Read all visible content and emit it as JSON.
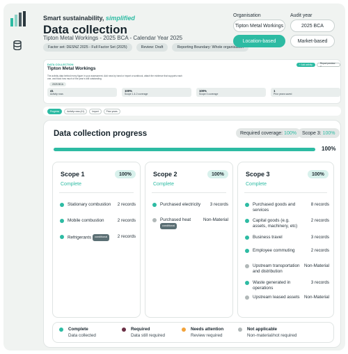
{
  "brand": {
    "tagline": "Smart sustainability,",
    "tagline_accent": "simplified"
  },
  "header": {
    "title": "Data collection",
    "subtitle": "Tipton Metal Workings - 2025 BCA - Calendar Year 2025",
    "pills": [
      "Factor set: DESNZ 2025 - Full Factor Set (2025)",
      "Review: Draft",
      "Reporting Boundary: Whole organisation"
    ]
  },
  "controls": {
    "organisation_label": "Organisation",
    "organisation_value": "Tipton Metal Workings",
    "audit_year_label": "Audit year",
    "audit_year_value": "2025 BCA",
    "location_button": "Location-based",
    "market_button": "Market-based"
  },
  "mini_card": {
    "eyebrow": "DATA COLLECTION",
    "title": "Tipton Metal Workings",
    "description": "The activity data behind every figure in your assessment. Add rows by hand or import a workbook, attach the evidence that supports each one, and track how much of the year is still outstanding.",
    "tag": "2025 BCA",
    "add_button": "+ Add activity",
    "report_button": "Report preview >",
    "stats": [
      {
        "value": "41",
        "label": "Activity rows"
      },
      {
        "value": "100%",
        "label": "Scope 1 & 2 coverage"
      },
      {
        "value": "100%",
        "label": "Scope 3 coverage"
      },
      {
        "value": "1",
        "label": "Prior years saved"
      }
    ]
  },
  "tabs": [
    "Progress",
    "Activity rows (41)",
    "Import",
    "Prior years"
  ],
  "progress": {
    "title": "Data collection progress",
    "required_coverage_label": "Required coverage:",
    "required_coverage_value": "100%",
    "scope3_label": "Scope 3:",
    "scope3_value": "100%",
    "overall_pct_text": "100%",
    "overall_fraction": 1.0
  },
  "scopes": [
    {
      "title": "Scope 1",
      "pct": "100%",
      "status": "Complete",
      "items": [
        {
          "label": "Stationary combustion",
          "records": "2 records",
          "state": "complete",
          "conditional": ""
        },
        {
          "label": "Mobile combustion",
          "records": "2 records",
          "state": "complete",
          "conditional": ""
        },
        {
          "label": "Refrigerants",
          "records": "2 records",
          "state": "complete",
          "conditional": "conditional"
        }
      ]
    },
    {
      "title": "Scope 2",
      "pct": "100%",
      "status": "Complete",
      "items": [
        {
          "label": "Purchased electricity",
          "records": "3 records",
          "state": "complete",
          "conditional": ""
        },
        {
          "label": "Purchased heat",
          "records": "Non-Material",
          "state": "na",
          "conditional": "conditional"
        }
      ]
    },
    {
      "title": "Scope 3",
      "pct": "100%",
      "status": "Complete",
      "items": [
        {
          "label": "Purchased goods and services",
          "records": "8 records",
          "state": "complete",
          "conditional": ""
        },
        {
          "label": "Capital goods (e.g. assets, machinery, etc)",
          "records": "2 records",
          "state": "complete",
          "conditional": ""
        },
        {
          "label": "Business travel",
          "records": "3 records",
          "state": "complete",
          "conditional": ""
        },
        {
          "label": "Employee commuting",
          "records": "2 records",
          "state": "complete",
          "conditional": ""
        },
        {
          "label": "Upstream transportation and distribution",
          "records": "Non-Material",
          "state": "na",
          "conditional": ""
        },
        {
          "label": "Waste generated in operations",
          "records": "3 records",
          "state": "complete",
          "conditional": ""
        },
        {
          "label": "Upstream leased assets",
          "records": "Non-Material",
          "state": "na",
          "conditional": ""
        }
      ]
    }
  ],
  "legend": [
    {
      "title": "Complete",
      "desc": "Data collected",
      "color": "#2dbba3"
    },
    {
      "title": "Required",
      "desc": "Data still required",
      "color": "#6b2f45"
    },
    {
      "title": "Needs attention",
      "desc": "Review required",
      "color": "#f2a33a"
    },
    {
      "title": "Not applicable",
      "desc": "Non-material/not required",
      "color": "#b1b8b8"
    }
  ]
}
